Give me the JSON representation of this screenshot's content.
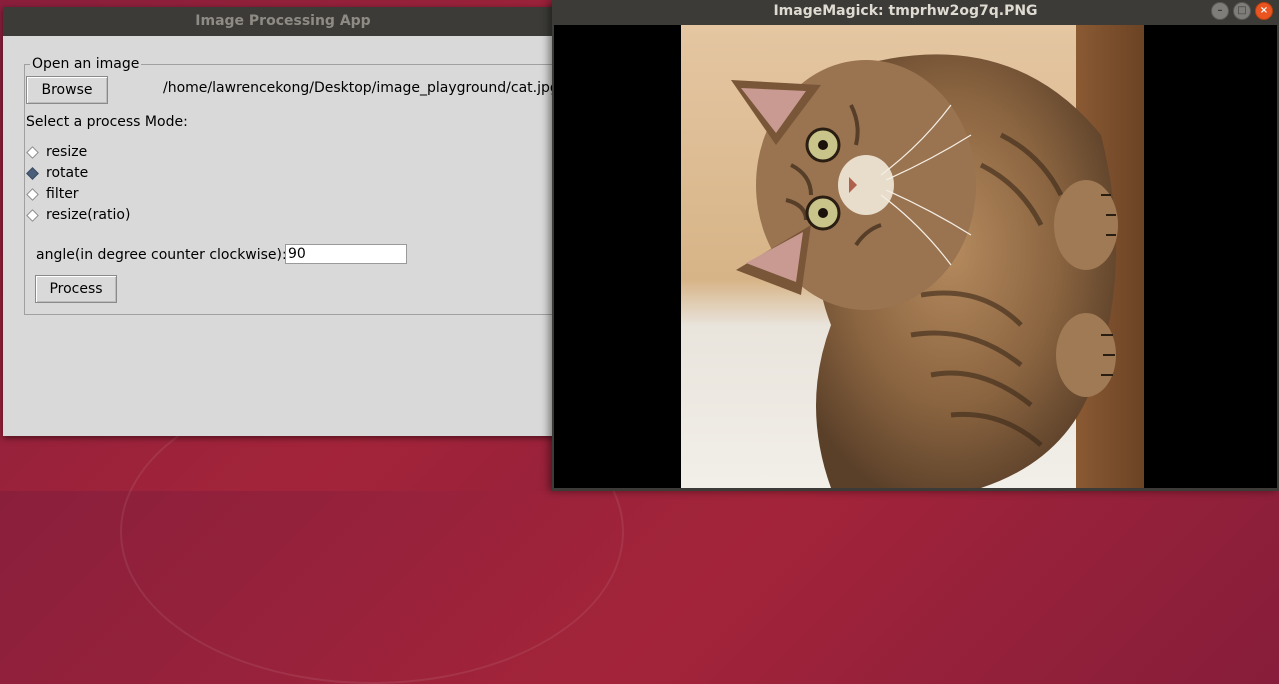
{
  "tk_app": {
    "title": "Image Processing App",
    "group_label": "Open an image",
    "browse_label": "Browse",
    "file_path": "/home/lawrencekong/Desktop/image_playground/cat.jpg",
    "mode_prompt": "Select a process Mode:",
    "modes": [
      {
        "label": "resize",
        "selected": false
      },
      {
        "label": "rotate",
        "selected": true
      },
      {
        "label": "filter",
        "selected": false
      },
      {
        "label": "resize(ratio)",
        "selected": false
      }
    ],
    "angle_label": "angle(in degree counter clockwise):",
    "angle_value": "90",
    "process_label": "Process"
  },
  "image_viewer": {
    "title": "ImageMagick: tmprhw2og7q.PNG",
    "controls": {
      "minimize": "–",
      "maximize": "□",
      "close": "×"
    }
  },
  "colors": {
    "titlebar": "#3c3b37",
    "tk_bg": "#d9d9d9",
    "close_button": "#e95420",
    "radio_selected": "#4a5f7a"
  }
}
